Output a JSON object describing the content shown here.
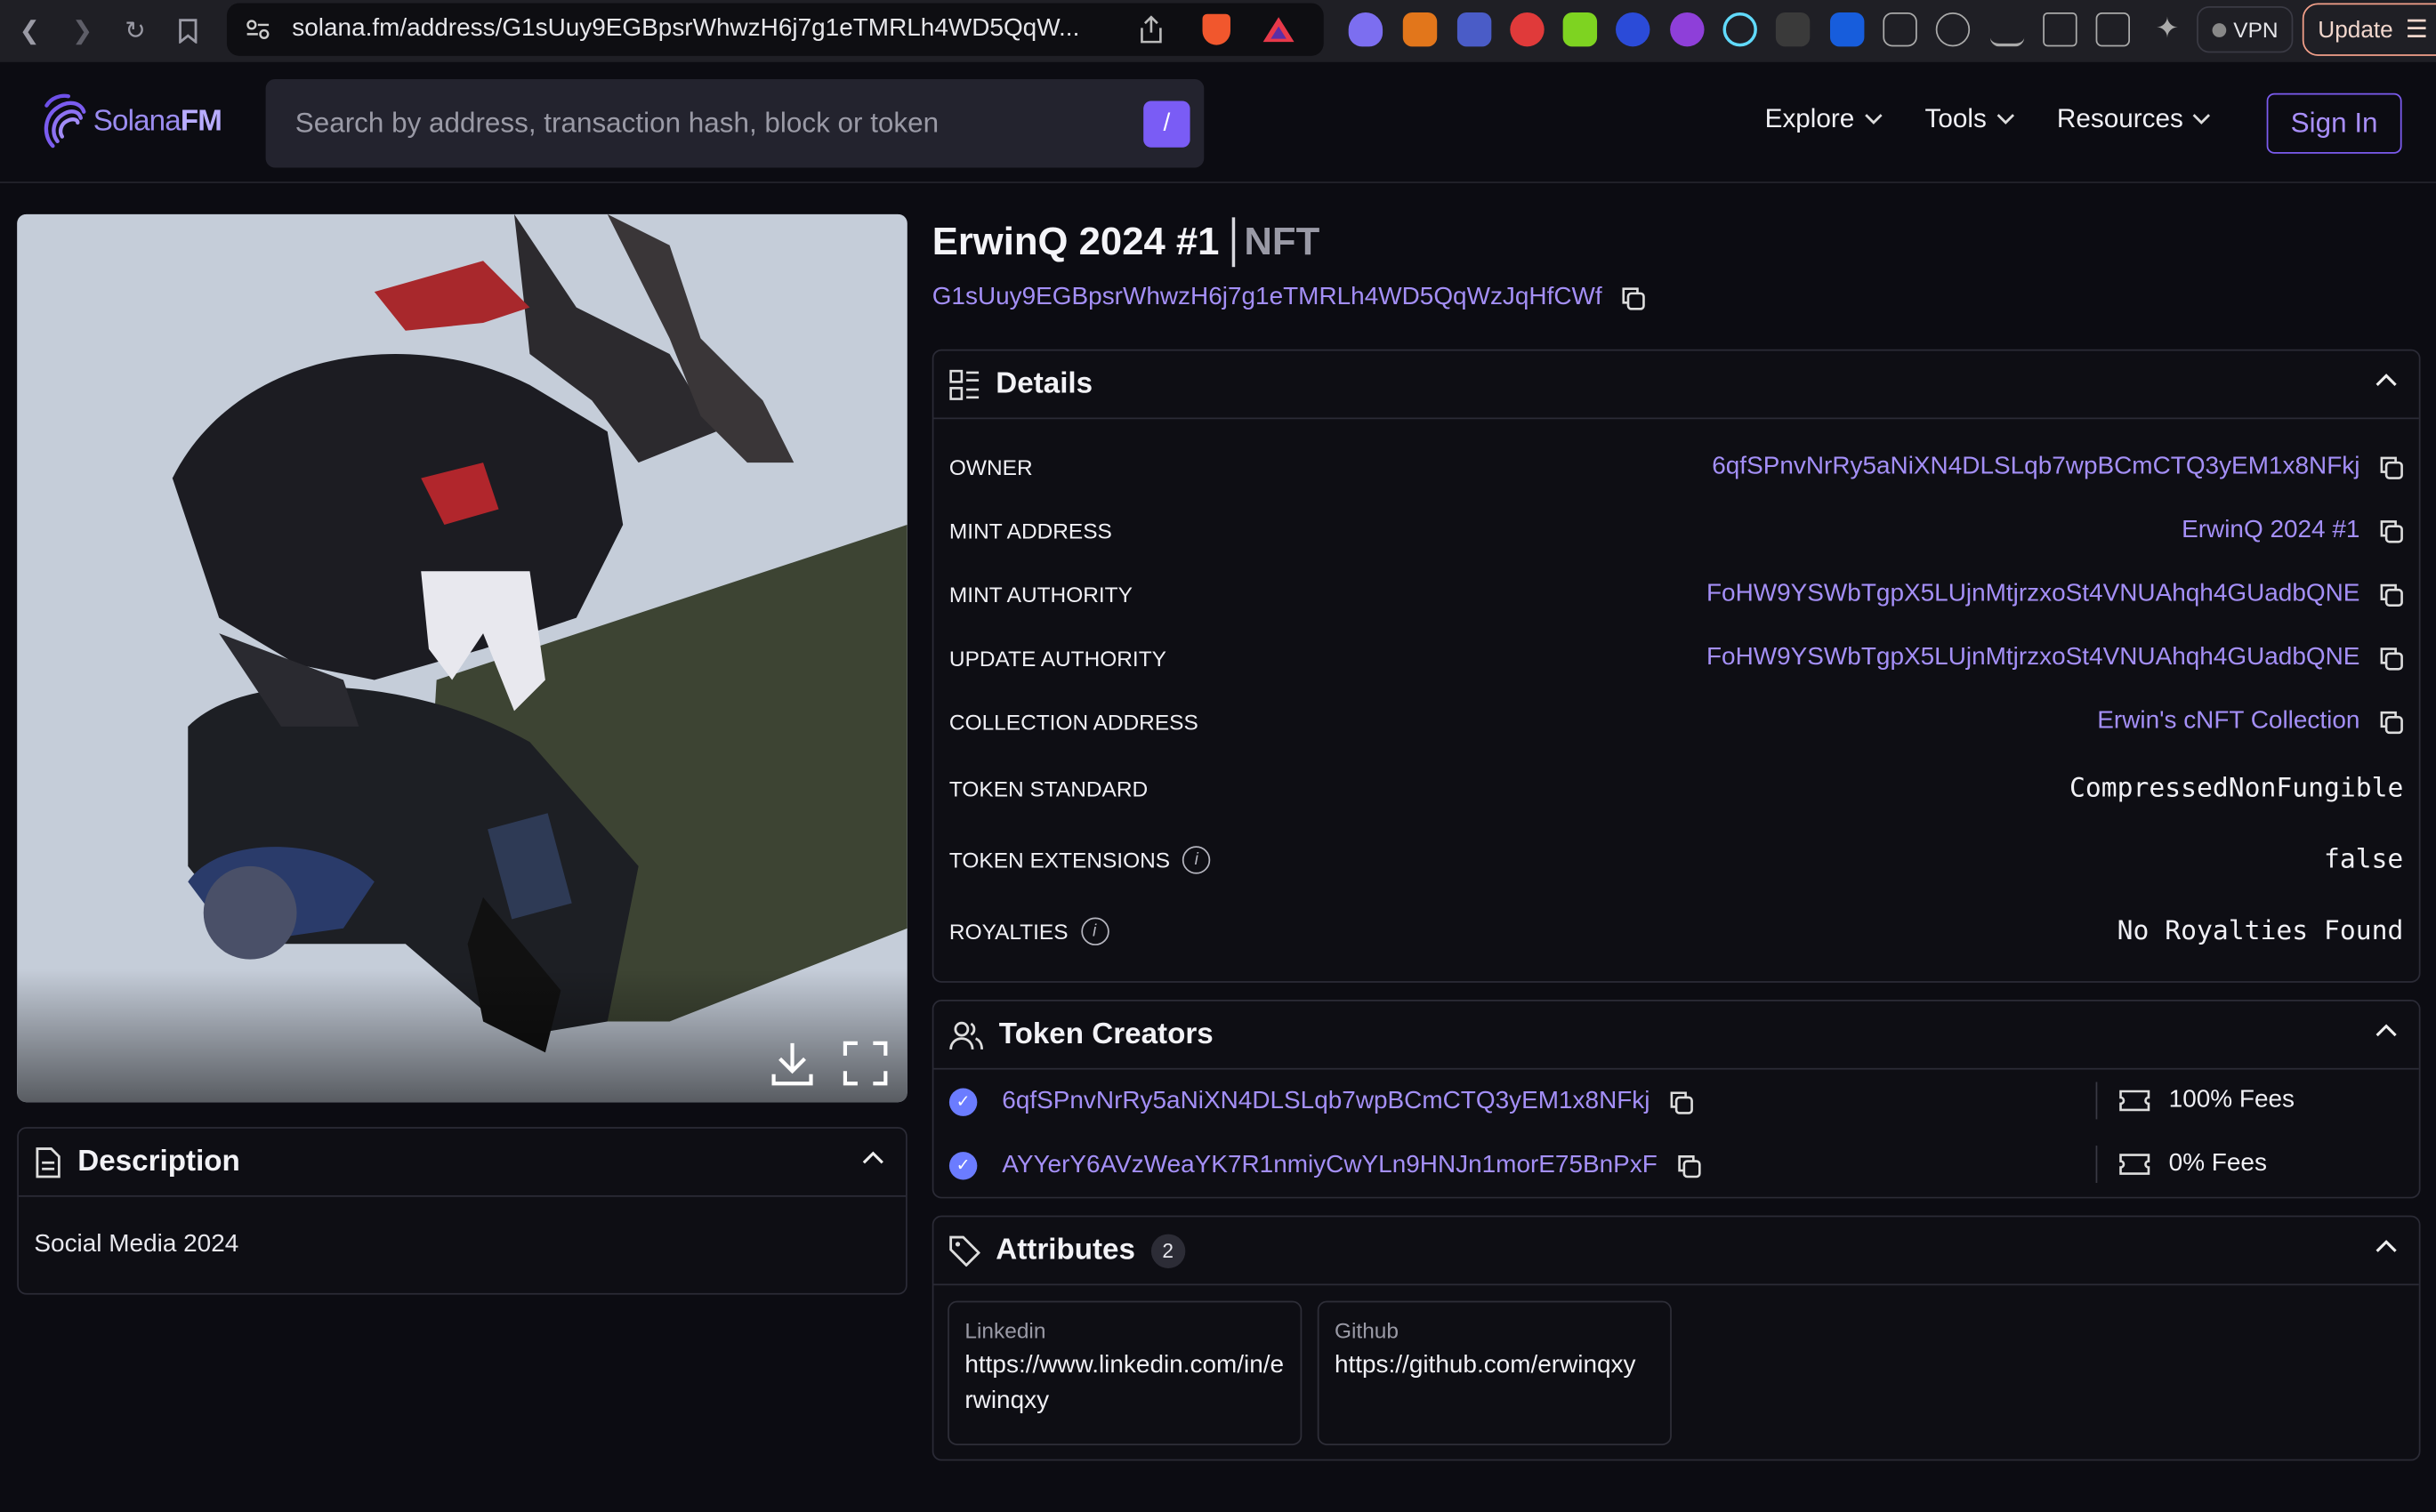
{
  "browser": {
    "url": "solana.fm/address/G1sUuy9EGBpsrWhwzH6j7g1eTMRLh4WD5QqW...",
    "vpn_label": "VPN",
    "update_label": "Update"
  },
  "nav": {
    "logo_text_a": "Solana",
    "logo_text_b": "FM",
    "search_placeholder": "Search by address, transaction hash, block or token",
    "slash": "/",
    "explore": "Explore",
    "tools": "Tools",
    "resources": "Resources",
    "sign_in": "Sign In"
  },
  "token": {
    "name": "ErwinQ 2024 #1",
    "type": "NFT",
    "address": "G1sUuy9EGBpsrWhwzH6j7g1eTMRLh4WD5QqWzJqHfCWf"
  },
  "description": {
    "title": "Description",
    "text": "Social Media 2024"
  },
  "details": {
    "title": "Details",
    "rows": [
      {
        "key": "OWNER",
        "value": "6qfSPnvNrRy5aNiXN4DLSLqb7wpBCmCTQ3yEM1x8NFkj"
      },
      {
        "key": "MINT ADDRESS",
        "value": "ErwinQ 2024 #1"
      },
      {
        "key": "MINT AUTHORITY",
        "value": "FoHW9YSWbTgpX5LUjnMtjrzxoSt4VNUAhqh4GUadbQNE"
      },
      {
        "key": "UPDATE AUTHORITY",
        "value": "FoHW9YSWbTgpX5LUjnMtjrzxoSt4VNUAhqh4GUadbQNE"
      },
      {
        "key": "COLLECTION ADDRESS",
        "value": "Erwin's cNFT Collection"
      },
      {
        "key": "TOKEN STANDARD",
        "value": "CompressedNonFungible"
      },
      {
        "key": "TOKEN EXTENSIONS",
        "value": "false"
      },
      {
        "key": "ROYALTIES",
        "value": "No Royalties Found"
      }
    ]
  },
  "creators": {
    "title": "Token Creators",
    "items": [
      {
        "address": "6qfSPnvNrRy5aNiXN4DLSLqb7wpBCmCTQ3yEM1x8NFkj",
        "fee": "100% Fees"
      },
      {
        "address": "AYYerY6AVzWeaYK7R1nmiyCwYLn9HNJn1morE75BnPxF",
        "fee": "0% Fees"
      }
    ]
  },
  "attributes": {
    "title": "Attributes",
    "count": "2",
    "items": [
      {
        "trait": "Linkedin",
        "value": "https://www.linkedin.com/in/erwinqxy"
      },
      {
        "trait": "Github",
        "value": "https://github.com/erwinqxy"
      }
    ]
  },
  "colors": {
    "accent": "#7a5cf5",
    "link": "#a48ff7",
    "background": "#0c0c12"
  }
}
